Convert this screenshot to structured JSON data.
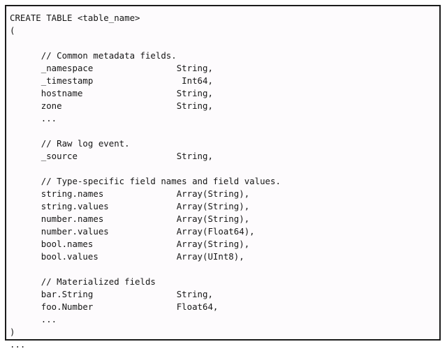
{
  "figure": {
    "kind": "code-snippet-figure",
    "language": "sql",
    "border_color": "#1b1b1b",
    "background_color": "#fdfbfd",
    "text_color": "#161616",
    "indent_spaces": 6,
    "type_column": 32
  },
  "code": {
    "lines": [
      "CREATE TABLE <table_name>",
      "(",
      "",
      "      // Common metadata fields.",
      "      _namespace                String,",
      "      _timestamp                 Int64,",
      "      hostname                  String,",
      "      zone                      String,",
      "      ...",
      "",
      "      // Raw log event.",
      "      _source                   String,",
      "",
      "      // Type-specific field names and field values.",
      "      string.names              Array(String),",
      "      string.values             Array(String),",
      "      number.names              Array(String),",
      "      number.values             Array(Float64),",
      "      bool.names                Array(String),",
      "      bool.values               Array(UInt8),",
      "",
      "      // Materialized fields",
      "      bar.String                String,",
      "      foo.Number                Float64,",
      "      ...",
      ")",
      "..."
    ],
    "statement_keyword": "CREATE TABLE",
    "table_name_placeholder": "<table_name>",
    "open_paren": "(",
    "close_paren": ")",
    "trailing_ellipsis": "...",
    "comments": [
      "// Common metadata fields.",
      "// Raw log event.",
      "// Type-specific field names and field values.",
      "// Materialized fields"
    ],
    "columns": [
      {
        "name": "_namespace",
        "type": "String,"
      },
      {
        "name": "_timestamp",
        "type": "Int64,"
      },
      {
        "name": "hostname",
        "type": "String,"
      },
      {
        "name": "zone",
        "type": "String,"
      },
      {
        "name": "_source",
        "type": "String,"
      },
      {
        "name": "string.names",
        "type": "Array(String),"
      },
      {
        "name": "string.values",
        "type": "Array(String),"
      },
      {
        "name": "number.names",
        "type": "Array(String),"
      },
      {
        "name": "number.values",
        "type": "Array(Float64),"
      },
      {
        "name": "bool.names",
        "type": "Array(String),"
      },
      {
        "name": "bool.values",
        "type": "Array(UInt8),"
      },
      {
        "name": "bar.String",
        "type": "String,"
      },
      {
        "name": "foo.Number",
        "type": "Float64,"
      }
    ]
  }
}
